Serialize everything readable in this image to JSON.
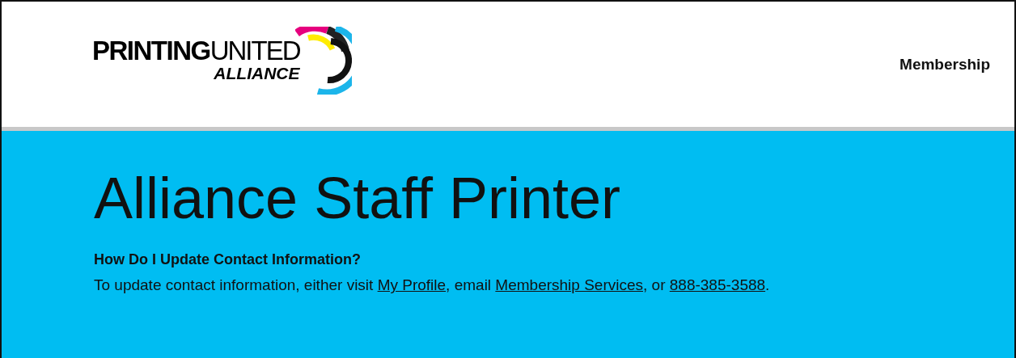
{
  "header": {
    "logo": {
      "bold": "PRINTING",
      "light": "UNITED",
      "sub": "ALLIANCE"
    },
    "nav": [
      {
        "label": "Membership"
      }
    ]
  },
  "hero": {
    "title": "Alliance Staff Printer",
    "question": "How Do I Update Contact Information?",
    "answer": [
      {
        "kind": "text",
        "text": "To update contact information, either visit "
      },
      {
        "kind": "link",
        "text": "My Profile"
      },
      {
        "kind": "text",
        "text": ", email "
      },
      {
        "kind": "link",
        "text": "Membership Services"
      },
      {
        "kind": "text",
        "text": ", or "
      },
      {
        "kind": "link",
        "text": "888-385-3588"
      },
      {
        "kind": "text",
        "text": "."
      }
    ]
  }
}
